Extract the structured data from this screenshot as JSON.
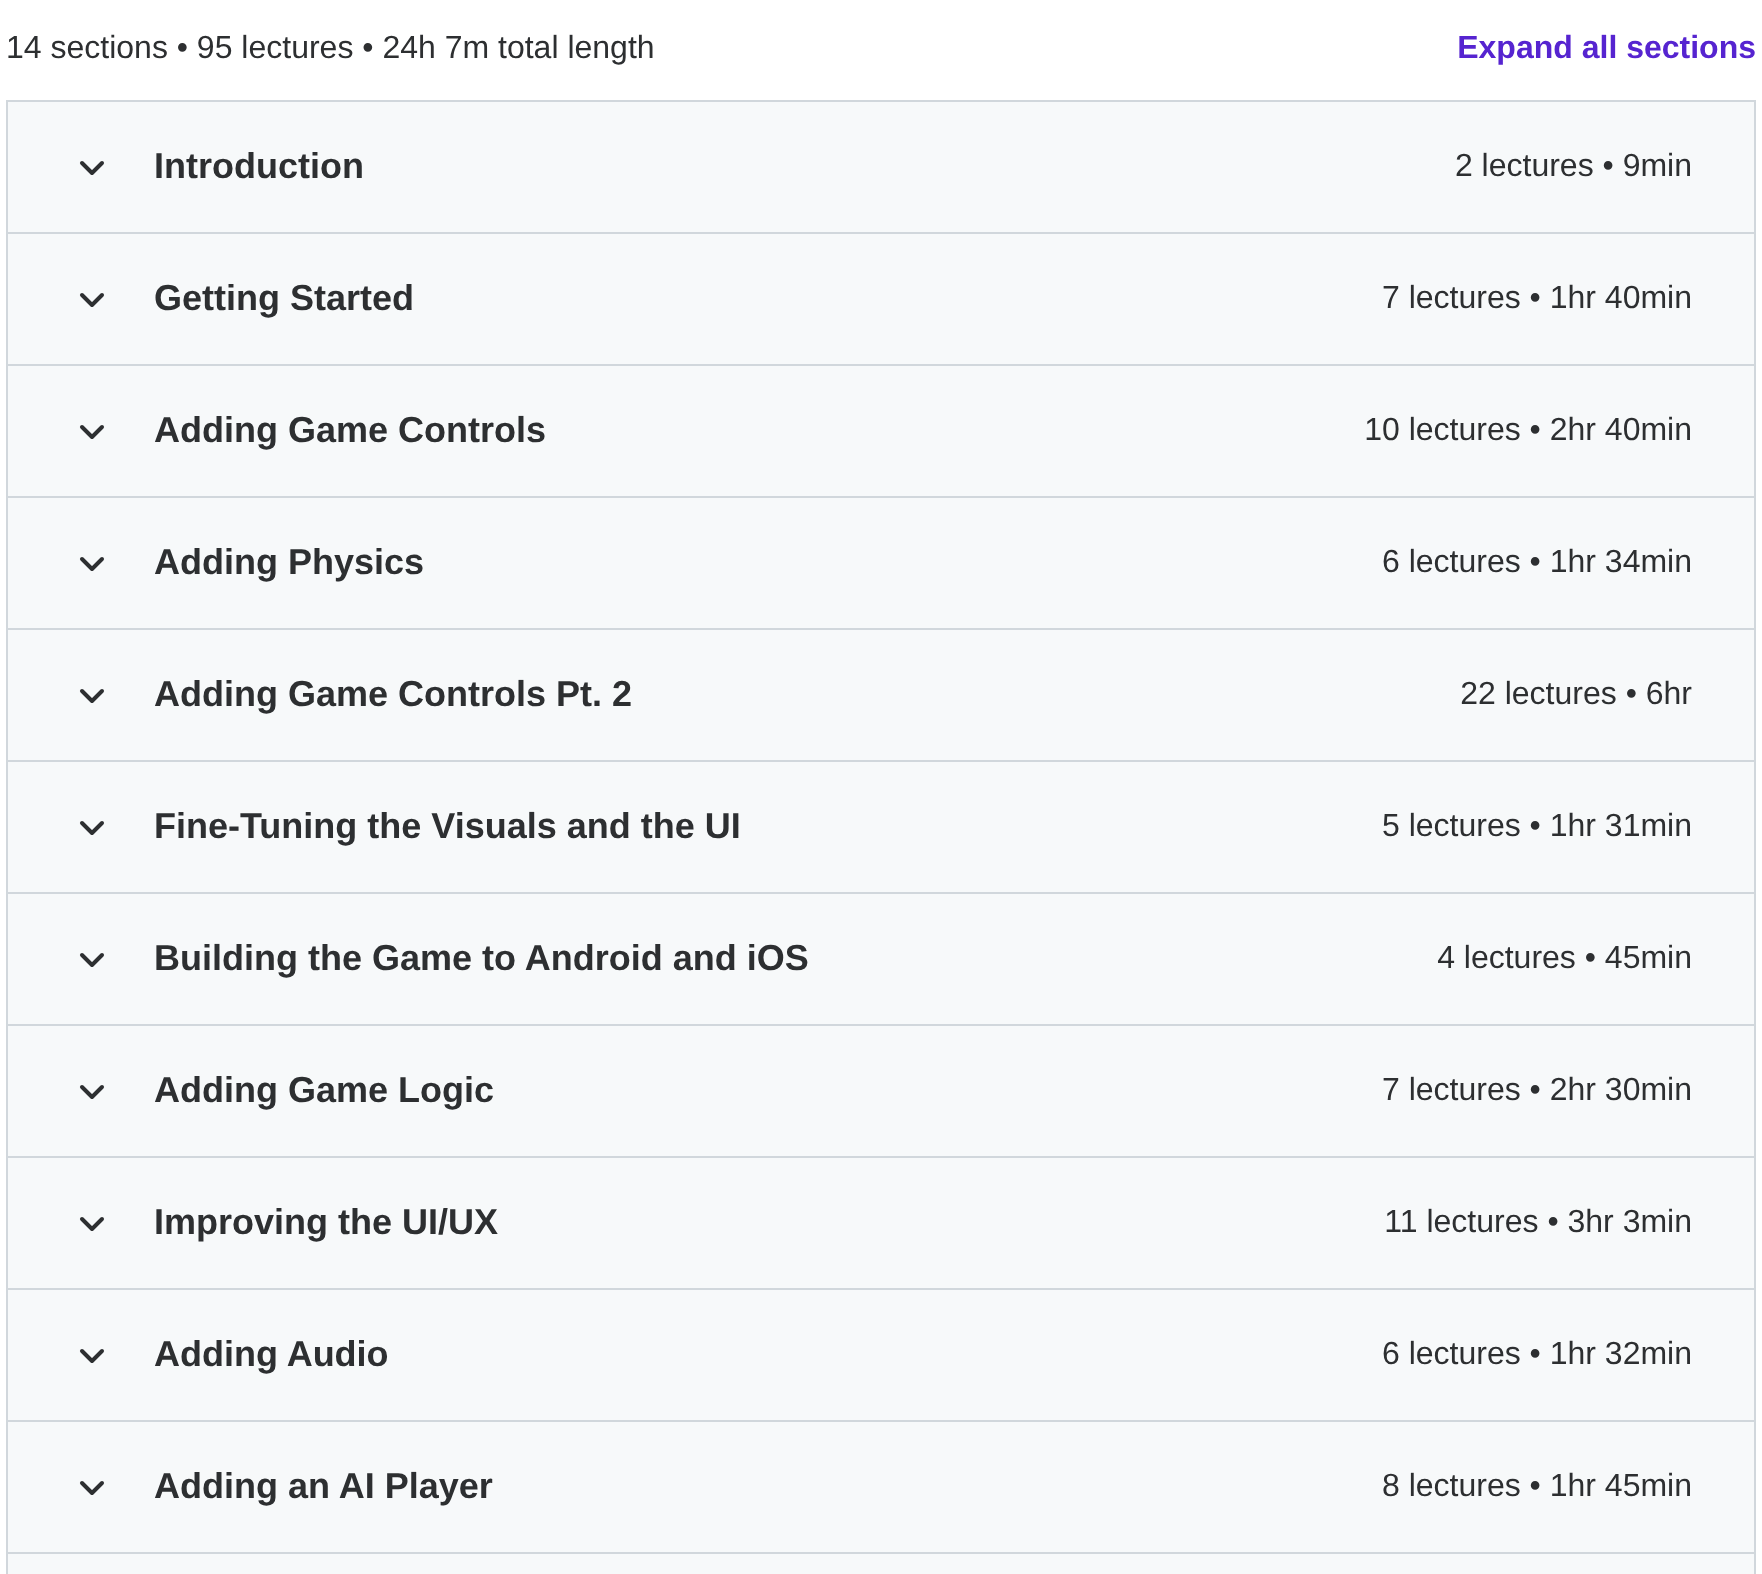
{
  "summary": "14 sections • 95 lectures • 24h 7m total length",
  "expand_all": "Expand all sections",
  "sections": [
    {
      "title": "Introduction",
      "meta": "2 lectures • 9min",
      "expanded": false
    },
    {
      "title": "Getting Started",
      "meta": "7 lectures • 1hr 40min",
      "expanded": false
    },
    {
      "title": "Adding Game Controls",
      "meta": "10 lectures • 2hr 40min",
      "expanded": false
    },
    {
      "title": "Adding Physics",
      "meta": "6 lectures • 1hr 34min",
      "expanded": false
    },
    {
      "title": "Adding Game Controls Pt. 2",
      "meta": "22 lectures • 6hr",
      "expanded": false
    },
    {
      "title": "Fine-Tuning the Visuals and the UI",
      "meta": "5 lectures • 1hr 31min",
      "expanded": false
    },
    {
      "title": "Building the Game to Android and iOS",
      "meta": "4 lectures • 45min",
      "expanded": false
    },
    {
      "title": "Adding Game Logic",
      "meta": "7 lectures • 2hr 30min",
      "expanded": false
    },
    {
      "title": "Improving the UI/UX",
      "meta": "11 lectures • 3hr 3min",
      "expanded": false
    },
    {
      "title": "Adding Audio",
      "meta": "6 lectures • 1hr 32min",
      "expanded": false
    },
    {
      "title": "Adding an AI Player",
      "meta": "8 lectures • 1hr 45min",
      "expanded": false
    }
  ]
}
